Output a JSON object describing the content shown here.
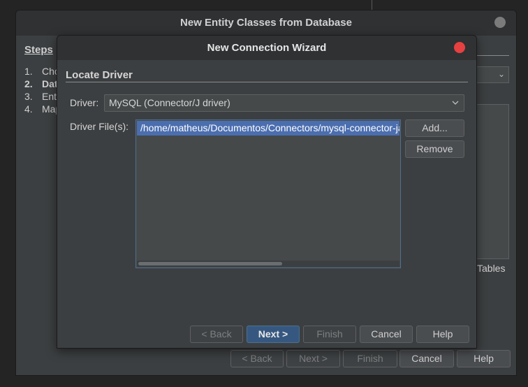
{
  "background_dialog": {
    "title": "New Entity Classes from Database",
    "steps_title": "Steps",
    "steps": [
      {
        "num": "1.",
        "label": "Cho"
      },
      {
        "num": "2.",
        "label": "Dat"
      },
      {
        "num": "3.",
        "label": "Ent"
      },
      {
        "num": "4.",
        "label": "Map"
      }
    ],
    "tables_label": "Tables",
    "buttons": {
      "back": "< Back",
      "next": "Next >",
      "finish": "Finish",
      "cancel": "Cancel",
      "help": "Help"
    }
  },
  "wizard": {
    "title": "New Connection Wizard",
    "section_title": "Locate Driver",
    "driver_label": "Driver:",
    "driver_value": "MySQL (Connector/J driver)",
    "driver_files_label": "Driver File(s):",
    "driver_files": [
      "/home/matheus/Documentos/Connectors/mysql-connector-java.jar"
    ],
    "add_button": "Add...",
    "remove_button": "Remove",
    "buttons": {
      "back": "< Back",
      "next": "Next >",
      "finish": "Finish",
      "cancel": "Cancel",
      "help": "Help"
    }
  },
  "colors": {
    "window_bg": "#3c3f41",
    "titlebar_bg": "#2f3133",
    "close_active": "#e74040",
    "close_inactive": "#7b7b7b",
    "selection": "#4b6eaf",
    "primary_button": "#365880"
  }
}
